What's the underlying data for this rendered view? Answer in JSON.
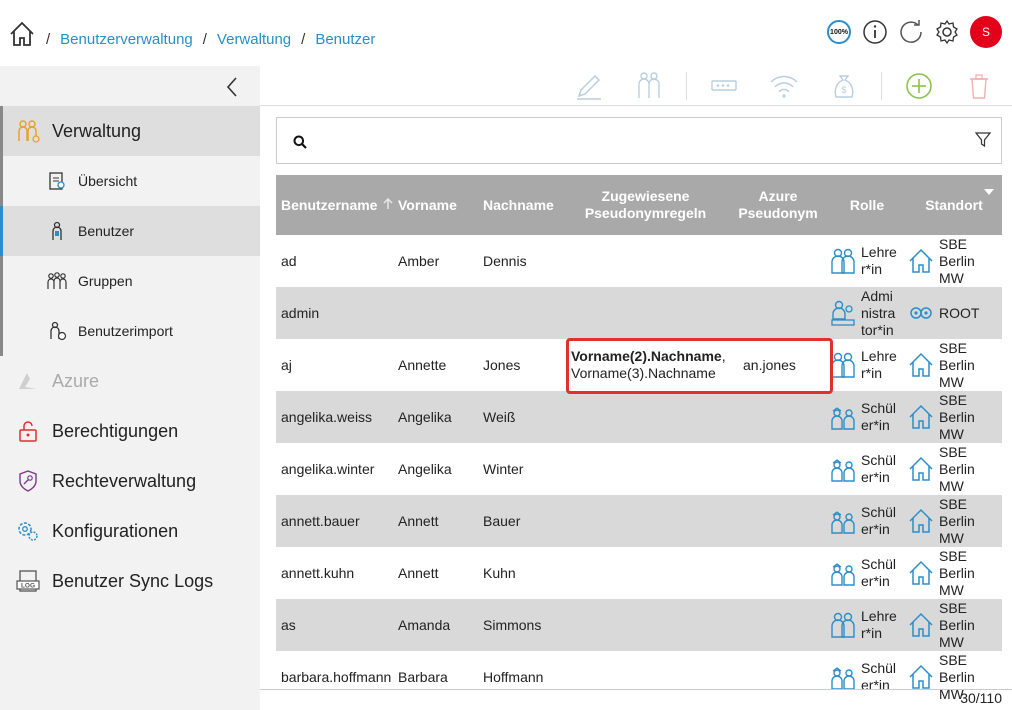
{
  "breadcrumb": {
    "items": [
      "Benutzerverwaltung",
      "Verwaltung",
      "Benutzer"
    ],
    "separator": "/"
  },
  "header": {
    "zoom_label": "100%",
    "avatar_initial": "S",
    "icons": [
      "home-icon",
      "zoom-icon",
      "info-icon",
      "refresh-icon",
      "gear-icon",
      "avatar"
    ]
  },
  "sidebar": {
    "sections": [
      {
        "label": "Verwaltung",
        "icon": "admin-users-icon",
        "active": true
      },
      {
        "label": "Azure",
        "icon": "azure-icon",
        "disabled": true
      },
      {
        "label": "Berechtigungen",
        "icon": "unlock-icon"
      },
      {
        "label": "Rechteverwaltung",
        "icon": "shield-key-icon"
      },
      {
        "label": "Konfigurationen",
        "icon": "gears-icon"
      },
      {
        "label": "Benutzer Sync Logs",
        "icon": "log-icon"
      }
    ],
    "subitems": [
      {
        "label": "Übersicht",
        "icon": "overview-icon"
      },
      {
        "label": "Benutzer",
        "icon": "user-icon",
        "active": true
      },
      {
        "label": "Gruppen",
        "icon": "group-icon"
      },
      {
        "label": "Benutzerimport",
        "icon": "user-import-icon"
      }
    ]
  },
  "toolbar": {
    "tools": [
      "edit-icon",
      "assign-users-icon",
      "password-icon",
      "wifi-icon",
      "money-icon",
      "add-icon",
      "delete-icon"
    ]
  },
  "search": {
    "value": "",
    "placeholder": ""
  },
  "table": {
    "columns": [
      "Benutzername",
      "Vorname",
      "Nachname",
      "Zugewiesene Pseudonymregeln",
      "Azure Pseudonym",
      "Rolle",
      "Standort"
    ],
    "sort_column": "Benutzername",
    "rows": [
      {
        "username": "ad",
        "first": "Amber",
        "last": "Dennis",
        "rules_bold": "",
        "rules_rest": "",
        "rules_line2": "",
        "azure": "",
        "role": "Lehrer*in",
        "role_icon": "teacher-icon",
        "site": "SBE Berlin MW",
        "site_icon": "house-icon"
      },
      {
        "username": "admin",
        "first": "",
        "last": "",
        "rules_bold": "",
        "rules_rest": "",
        "rules_line2": "",
        "azure": "",
        "role": "Administrator*in",
        "role_icon": "administrator-icon",
        "site": "ROOT",
        "site_icon": "root-icon"
      },
      {
        "username": "aj",
        "first": "Annette",
        "last": "Jones",
        "rules_bold": "Vorname(2).Nachname",
        "rules_rest": ",",
        "rules_line2": "Vorname(3).Nachname",
        "azure": "an.jones",
        "role": "Lehrer*in",
        "role_icon": "teacher-icon",
        "site": "SBE Berlin MW",
        "site_icon": "house-icon"
      },
      {
        "username": "angelika.weiss",
        "first": "Angelika",
        "last": "Weiß",
        "rules_bold": "",
        "rules_rest": "",
        "rules_line2": "",
        "azure": "",
        "role": "Schüler*in",
        "role_icon": "student-icon",
        "site": "SBE Berlin MW",
        "site_icon": "house-icon"
      },
      {
        "username": "angelika.winter",
        "first": "Angelika",
        "last": "Winter",
        "rules_bold": "",
        "rules_rest": "",
        "rules_line2": "",
        "azure": "",
        "role": "Schüler*in",
        "role_icon": "student-icon",
        "site": "SBE Berlin MW",
        "site_icon": "house-icon"
      },
      {
        "username": "annett.bauer",
        "first": "Annett",
        "last": "Bauer",
        "rules_bold": "",
        "rules_rest": "",
        "rules_line2": "",
        "azure": "",
        "role": "Schüler*in",
        "role_icon": "student-icon",
        "site": "SBE Berlin MW",
        "site_icon": "house-icon"
      },
      {
        "username": "annett.kuhn",
        "first": "Annett",
        "last": "Kuhn",
        "rules_bold": "",
        "rules_rest": "",
        "rules_line2": "",
        "azure": "",
        "role": "Schüler*in",
        "role_icon": "student-icon",
        "site": "SBE Berlin MW",
        "site_icon": "house-icon"
      },
      {
        "username": "as",
        "first": "Amanda",
        "last": "Simmons",
        "rules_bold": "",
        "rules_rest": "",
        "rules_line2": "",
        "azure": "",
        "role": "Lehrer*in",
        "role_icon": "teacher-icon",
        "site": "SBE Berlin MW",
        "site_icon": "house-icon"
      },
      {
        "username": "barbara.hoffmann",
        "first": "Barbara",
        "last": "Hoffmann",
        "rules_bold": "",
        "rules_rest": "",
        "rules_line2": "",
        "azure": "",
        "role": "Schüler*in",
        "role_icon": "student-icon",
        "site": "SBE Berlin MW",
        "site_icon": "house-icon"
      }
    ]
  },
  "pager": {
    "text": "30/110"
  },
  "colors": {
    "accent": "#2a8ec9",
    "header_row": "#a9a9a9",
    "alt_row": "#d9d9d9",
    "highlight": "#e03030",
    "avatar": "#e3001b"
  }
}
